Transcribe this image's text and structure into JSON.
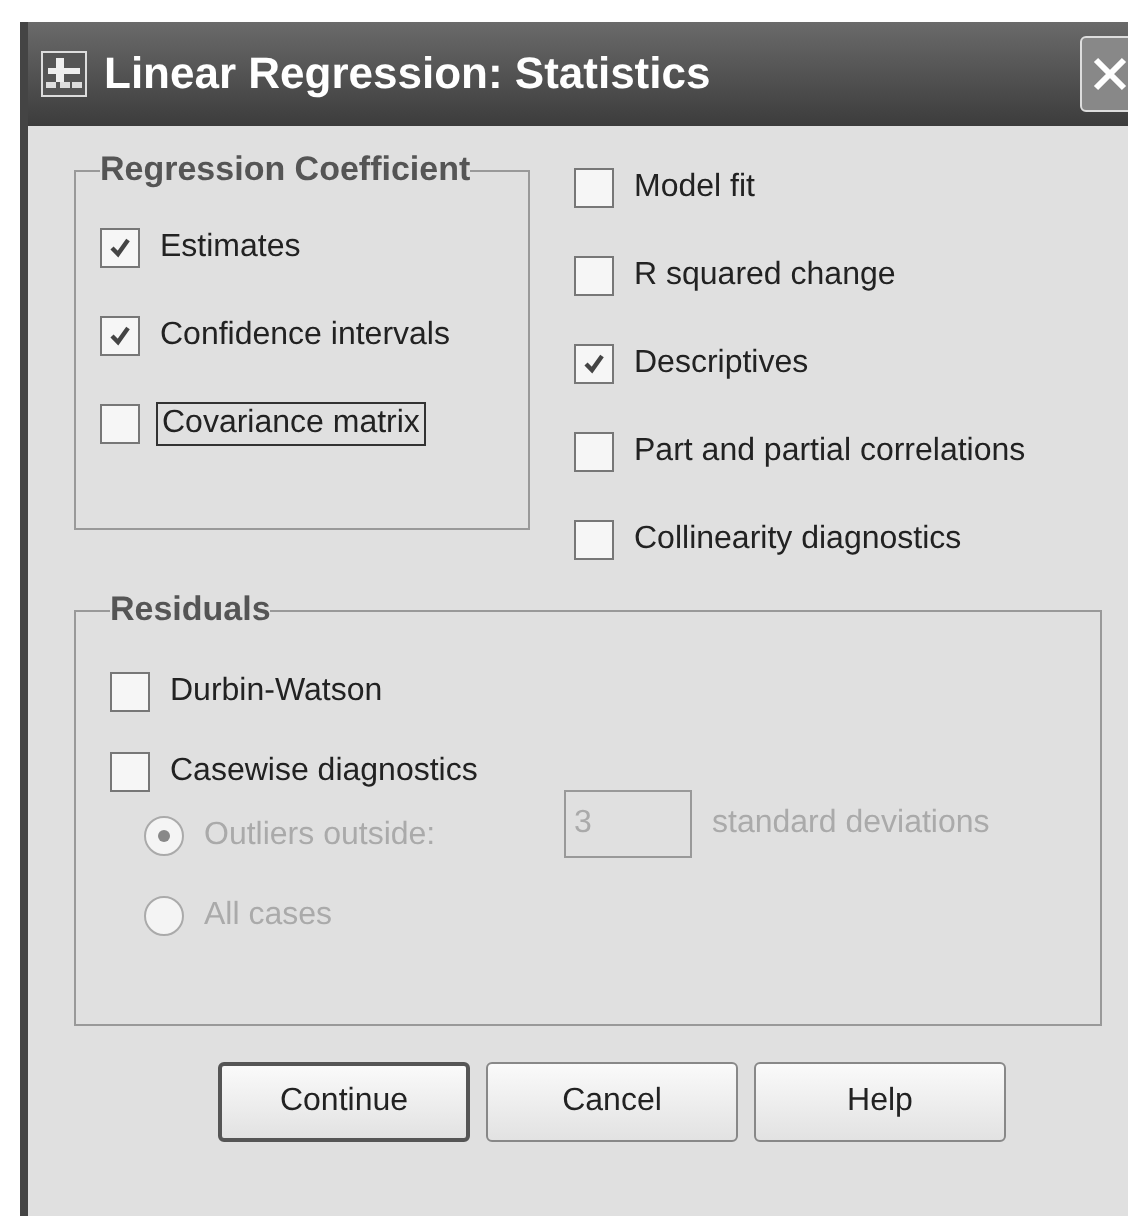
{
  "window": {
    "title": "Linear Regression: Statistics"
  },
  "regression_coefficient": {
    "title": "Regression Coefficient",
    "options": [
      {
        "label": "Estimates",
        "checked": true,
        "focused": false
      },
      {
        "label": "Confidence intervals",
        "checked": true,
        "focused": false
      },
      {
        "label": "Covariance matrix",
        "checked": false,
        "focused": true
      }
    ]
  },
  "options": [
    {
      "label": "Model fit",
      "checked": false
    },
    {
      "label": "R squared change",
      "checked": false
    },
    {
      "label": "Descriptives",
      "checked": true
    },
    {
      "label": "Part and partial correlations",
      "checked": false
    },
    {
      "label": "Collinearity diagnostics",
      "checked": false
    }
  ],
  "residuals": {
    "title": "Residuals",
    "options": [
      {
        "label": "Durbin-Watson",
        "checked": false
      },
      {
        "label": "Casewise diagnostics",
        "checked": false
      }
    ],
    "casewise": [
      {
        "label": "Outliers outside:",
        "selected": true,
        "disabled": true
      },
      {
        "label": "All cases",
        "selected": false,
        "disabled": true
      }
    ],
    "deviations": {
      "value": "3",
      "unit": "standard deviations",
      "disabled": true
    }
  },
  "buttons": [
    {
      "label": "Continue",
      "default": true
    },
    {
      "label": "Cancel",
      "default": false
    },
    {
      "label": "Help",
      "default": false
    }
  ]
}
